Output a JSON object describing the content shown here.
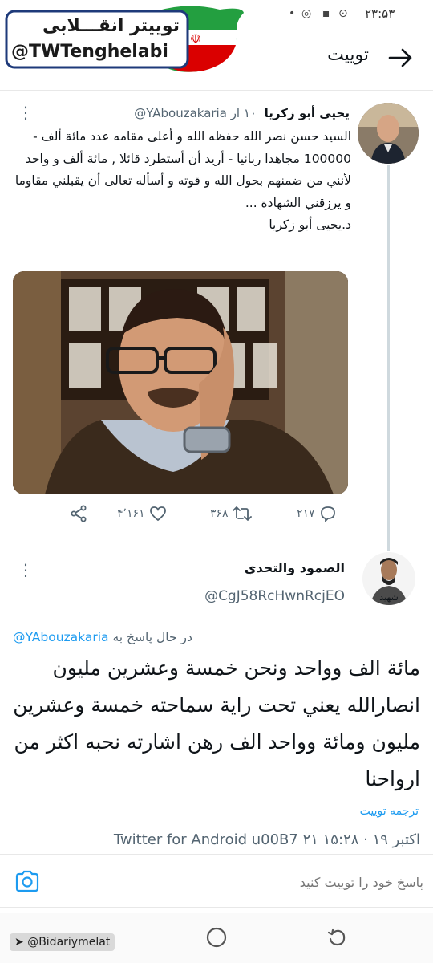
{
  "status_bar": {
    "time": "۲۳:۵۳"
  },
  "watermark": {
    "title": "توییتر انقـــلابی",
    "handle": "@TWTenghelabi"
  },
  "header": {
    "title": "توییت"
  },
  "tweet1": {
    "author_name": "يحيى أبو زكريا",
    "handle": "@YAbouzakaria",
    "time": "۱۰ ار",
    "text": "السيد حسن نصر الله حفظه الله و أعلى مقامه عدد مائة ألف - 100000 مجاهدا ربانيا - أريد أن أستطرد قائلا , مائة ألف و واحد لأنني من ضمنهم بحول الله و قوته و أسأله تعالى أن يقبلني مقاوما و يرزقني الشهادة ...\nد.يحيى أبو زكريا",
    "replies": "۲۱۷",
    "retweets": "۳۶۸",
    "likes": "۴٬۱۶۱"
  },
  "tweet2": {
    "author_name": "الصمود والتحدي",
    "handle": "@CgJ58RcHwnRcjEO",
    "reply_prefix": "در حال پاسخ به",
    "reply_handle": "@YAbouzakaria",
    "text": "مائة الف وواحد ونحن خمسة وعشرين مليون انصارالله يعني تحت راية سماحته خمسة وعشرين مليون ومائة وواحد الف رهن اشارته نحبه اكثر من ارواحنا",
    "translate_label": "ترجمه توییت",
    "meta": "Twitter for Android u00B7 ۲۱ اکتبر ۱۹ · ۱۵:۲۸"
  },
  "compose": {
    "placeholder": "پاسخ خود را توییت کنید"
  },
  "credit": {
    "label": "@Bidariymelat"
  },
  "colors": {
    "accent": "#1d9bf0",
    "secondary_text": "#536471",
    "flag_green": "#239f40",
    "flag_red": "#da0000"
  },
  "icons": [
    "whatsapp-icon",
    "gallery-icon",
    "circle-icon",
    "back-arrow-icon",
    "more-icon",
    "reply-icon",
    "retweet-icon",
    "like-icon",
    "share-icon",
    "camera-icon",
    "home-circle-icon",
    "recent-icon"
  ]
}
